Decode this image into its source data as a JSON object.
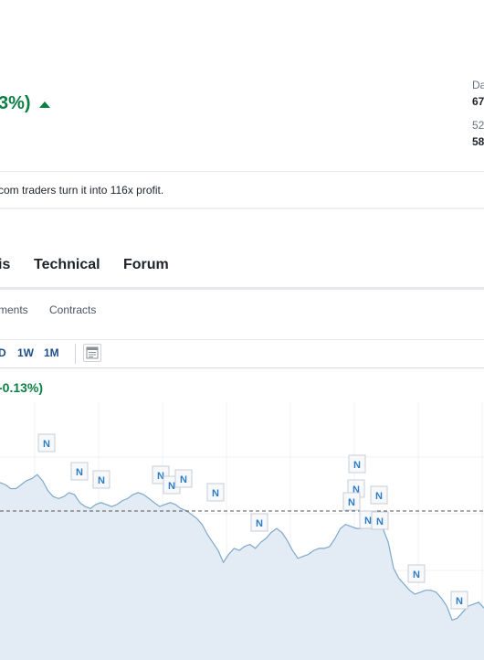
{
  "header": {
    "price_change_pct": "3%)",
    "change_direction_icon": "triangle-up-icon",
    "stats": [
      {
        "label": "Da",
        "value": "67"
      },
      {
        "label": "52",
        "value": "58"
      }
    ]
  },
  "promo": {
    "text": "com traders turn it into 116x profit."
  },
  "tabs": [
    {
      "label": "is"
    },
    {
      "label": "Technical"
    },
    {
      "label": "Forum"
    }
  ],
  "subtabs": [
    {
      "label": "ments"
    },
    {
      "label": "Contracts"
    }
  ],
  "ranges": [
    {
      "label": "D"
    },
    {
      "label": "1W"
    },
    {
      "label": "1M"
    }
  ],
  "chart_type_icon": "chart-table-icon",
  "chart_header": {
    "change_pct": "-0.13%)"
  },
  "colors": {
    "up": "#0a8043",
    "line": "#7ea8cc",
    "fill": "#e3ecf5",
    "news_marker": "#2e7cc4"
  },
  "chart_data": {
    "type": "area",
    "series": [
      {
        "values": [
          78,
          77,
          75,
          75,
          77,
          79,
          80,
          82,
          79,
          74,
          71,
          70,
          71,
          73,
          72,
          68,
          66,
          65,
          67,
          68,
          67,
          66,
          67,
          69,
          70,
          72,
          73,
          72,
          70,
          68,
          66,
          67,
          68,
          67,
          65,
          64,
          62,
          60,
          57,
          52,
          48,
          44,
          38,
          42,
          45,
          44,
          46,
          47,
          45,
          48,
          50,
          53,
          55,
          53,
          49,
          44,
          40,
          41,
          42,
          44,
          45,
          45,
          46,
          50,
          55,
          57,
          56,
          55,
          55,
          58,
          58,
          56,
          55,
          48,
          35,
          30,
          27,
          24,
          22,
          23,
          24,
          24,
          23,
          20,
          16,
          9,
          10,
          13,
          16,
          17,
          18,
          15
        ]
      }
    ],
    "reference_line": "dashed",
    "news_marker_label": "N",
    "news_markers_count": 19,
    "grid": true
  }
}
